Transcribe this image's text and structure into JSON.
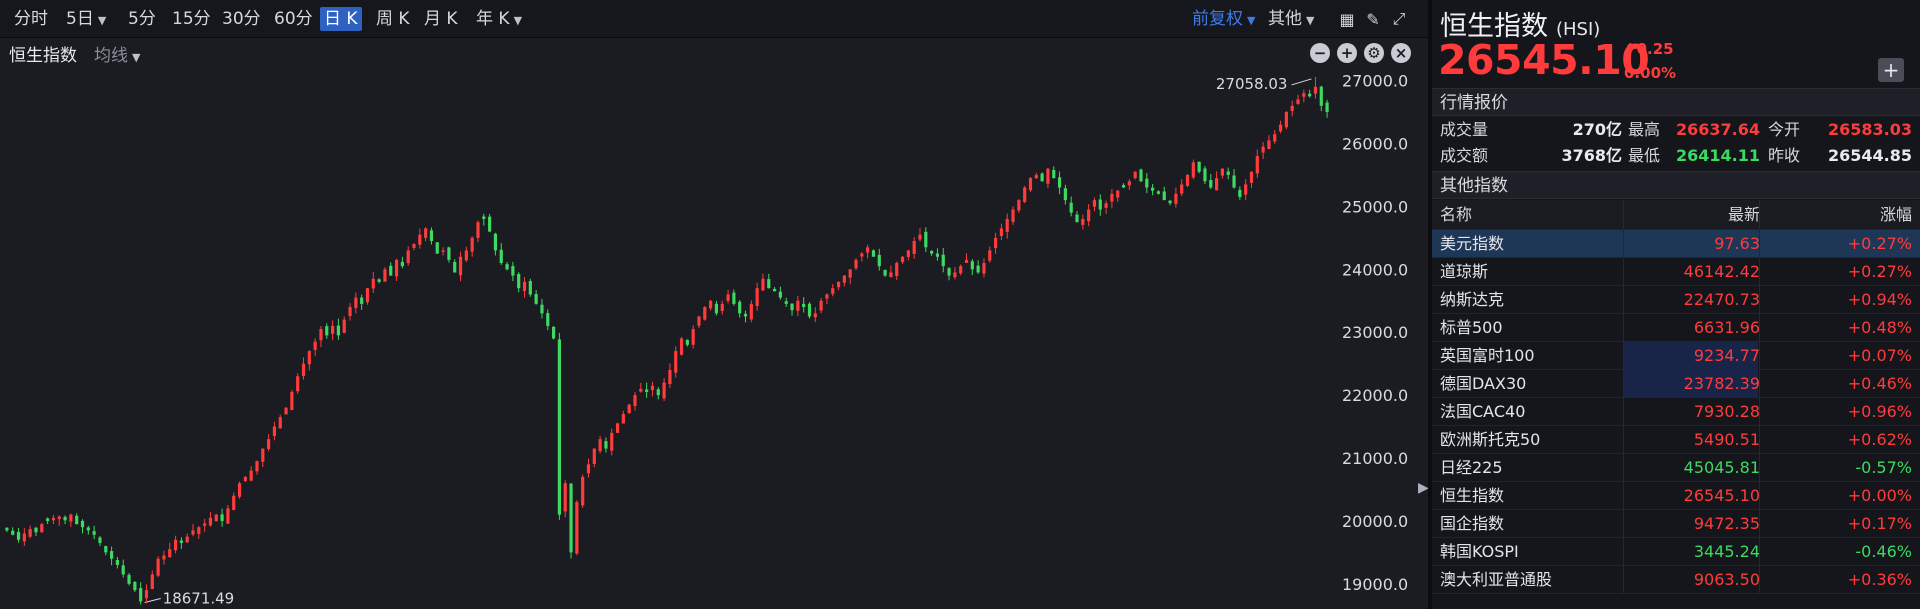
{
  "toolbar": {
    "periods": [
      {
        "label": "分时",
        "active": false,
        "caret": false
      },
      {
        "label": "5日",
        "active": false,
        "caret": true
      },
      {
        "label": "5分",
        "active": false,
        "caret": false
      },
      {
        "label": "15分",
        "active": false,
        "caret": false
      },
      {
        "label": "30分",
        "active": false,
        "caret": false
      },
      {
        "label": "60分",
        "active": false,
        "caret": false
      },
      {
        "label": "日 K",
        "active": true,
        "caret": false
      },
      {
        "label": "周 K",
        "active": false,
        "caret": false
      },
      {
        "label": "月 K",
        "active": false,
        "caret": false
      },
      {
        "label": "年 K",
        "active": false,
        "caret": true
      }
    ],
    "adjust_label": "前复权",
    "other_label": "其他",
    "icons": [
      "grid-layout-icon",
      "pen-draw-icon",
      "fullscreen-icon"
    ]
  },
  "subbar": {
    "title": "恒生指数",
    "ma_label": "均线",
    "buttons": [
      "zoom-out-icon",
      "zoom-in-icon",
      "settings-icon",
      "close-icon"
    ]
  },
  "chart_data": {
    "type": "candlestick",
    "ylim": [
      18600,
      27200
    ],
    "yticks": [
      19000.0,
      20000.0,
      21000.0,
      22000.0,
      23000.0,
      24000.0,
      25000.0,
      26000.0,
      27000.0
    ],
    "ytick_labels": [
      "19000.0",
      "20000.0",
      "21000.0",
      "22000.0",
      "23000.0",
      "24000.0",
      "25000.0",
      "26000.0",
      "27000.0"
    ],
    "up_color": "#ff3b3b",
    "down_color": "#3dd960",
    "annotations": {
      "high_label": "27058.03",
      "low_label": "18671.49"
    },
    "high": 27058.03,
    "low": 18671.49,
    "closes": [
      19850,
      19780,
      19700,
      19800,
      19870,
      19820,
      19950,
      20000,
      20050,
      20070,
      20010,
      20100,
      19950,
      19900,
      19850,
      19780,
      19650,
      19500,
      19400,
      19300,
      19150,
      19000,
      18900,
      18720,
      18900,
      19150,
      19400,
      19450,
      19550,
      19700,
      19650,
      19750,
      19850,
      19900,
      19960,
      20050,
      20100,
      20000,
      20200,
      20400,
      20600,
      20700,
      20800,
      20950,
      21150,
      21300,
      21500,
      21650,
      21800,
      22050,
      22300,
      22500,
      22700,
      22850,
      23050,
      22950,
      23100,
      22950,
      23200,
      23400,
      23550,
      23450,
      23700,
      23850,
      23800,
      24000,
      23900,
      24150,
      24050,
      24300,
      24400,
      24550,
      24650,
      24450,
      24250,
      24300,
      24150,
      23950,
      24200,
      24300,
      24500,
      24750,
      24800,
      24600,
      24300,
      24100,
      24000,
      23900,
      23700,
      23800,
      23600,
      23450,
      23300,
      23100,
      22900,
      20100,
      20600,
      19500,
      20300,
      20700,
      20900,
      21150,
      21300,
      21150,
      21400,
      21550,
      21700,
      21850,
      22000,
      22100,
      22050,
      22150,
      22000,
      22200,
      22400,
      22700,
      22900,
      22800,
      23050,
      23250,
      23400,
      23500,
      23300,
      23450,
      23600,
      23450,
      23300,
      23250,
      23450,
      23700,
      23850,
      23700,
      23650,
      23550,
      23450,
      23350,
      23500,
      23400,
      23250,
      23300,
      23500,
      23600,
      23700,
      23800,
      23900,
      24000,
      24150,
      24250,
      24350,
      24200,
      24050,
      23900,
      23950,
      24100,
      24200,
      24300,
      24450,
      24550,
      24350,
      24250,
      24200,
      24050,
      23900,
      23950,
      24050,
      24150,
      24000,
      23950,
      24100,
      24300,
      24500,
      24650,
      24800,
      24950,
      25100,
      25300,
      25450,
      25500,
      25400,
      25600,
      25450,
      25300,
      25100,
      24900,
      24750,
      24800,
      24950,
      25100,
      24950,
      25050,
      25200,
      25250,
      25300,
      25400,
      25550,
      25400,
      25300,
      25250,
      25200,
      25100,
      25050,
      25200,
      25350,
      25500,
      25700,
      25550,
      25400,
      25300,
      25450,
      25600,
      25500,
      25300,
      25150,
      25350,
      25550,
      25800,
      25950,
      26050,
      26150,
      26300,
      26500,
      26600,
      26700,
      26800,
      26750,
      26900,
      26600,
      26500
    ]
  },
  "side": {
    "name": "恒生指数",
    "code": "(HSI)",
    "price": "26545.10",
    "change": "0.25",
    "percent": "0.00%",
    "add_label": "+",
    "quote_header": "行情报价",
    "stats": {
      "vol_label": "成交量",
      "vol": "270亿",
      "high_label": "最高",
      "high": "26637.64",
      "open_label": "今开",
      "open": "26583.03",
      "amt_label": "成交额",
      "amt": "3768亿",
      "low_label": "最低",
      "low": "26414.11",
      "prev_label": "昨收",
      "prev": "26544.85"
    },
    "other_header": "其他指数",
    "table_headers": {
      "name": "名称",
      "last": "最新",
      "chg": "涨幅"
    },
    "indices": [
      {
        "name": "美元指数",
        "last": "97.63",
        "chg": "+0.27%",
        "dir": "up",
        "sel": true,
        "hl": false
      },
      {
        "name": "道琼斯",
        "last": "46142.42",
        "chg": "+0.27%",
        "dir": "up",
        "sel": false,
        "hl": false
      },
      {
        "name": "纳斯达克",
        "last": "22470.73",
        "chg": "+0.94%",
        "dir": "up",
        "sel": false,
        "hl": false
      },
      {
        "name": "标普500",
        "last": "6631.96",
        "chg": "+0.48%",
        "dir": "up",
        "sel": false,
        "hl": false
      },
      {
        "name": "英国富时100",
        "last": "9234.77",
        "chg": "+0.07%",
        "dir": "up",
        "sel": false,
        "hl": true
      },
      {
        "name": "德国DAX30",
        "last": "23782.39",
        "chg": "+0.46%",
        "dir": "up",
        "sel": false,
        "hl": true
      },
      {
        "name": "法国CAC40",
        "last": "7930.28",
        "chg": "+0.96%",
        "dir": "up",
        "sel": false,
        "hl": false
      },
      {
        "name": "欧洲斯托克50",
        "last": "5490.51",
        "chg": "+0.62%",
        "dir": "up",
        "sel": false,
        "hl": false
      },
      {
        "name": "日经225",
        "last": "45045.81",
        "chg": "-0.57%",
        "dir": "down",
        "sel": false,
        "hl": false
      },
      {
        "name": "恒生指数",
        "last": "26545.10",
        "chg": "+0.00%",
        "dir": "up",
        "sel": false,
        "hl": false
      },
      {
        "name": "国企指数",
        "last": "9472.35",
        "chg": "+0.17%",
        "dir": "up",
        "sel": false,
        "hl": false
      },
      {
        "name": "韩国KOSPI",
        "last": "3445.24",
        "chg": "-0.46%",
        "dir": "down",
        "sel": false,
        "hl": false
      },
      {
        "name": "澳大利亚普通股",
        "last": "9063.50",
        "chg": "+0.36%",
        "dir": "up",
        "sel": false,
        "hl": false
      }
    ]
  }
}
